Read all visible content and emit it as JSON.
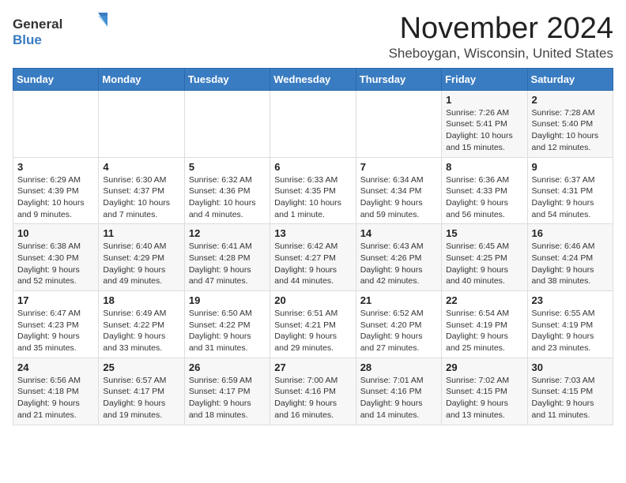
{
  "logo": {
    "general": "General",
    "blue": "Blue"
  },
  "title": "November 2024",
  "location": "Sheboygan, Wisconsin, United States",
  "weekdays": [
    "Sunday",
    "Monday",
    "Tuesday",
    "Wednesday",
    "Thursday",
    "Friday",
    "Saturday"
  ],
  "weeks": [
    [
      {
        "day": "",
        "info": ""
      },
      {
        "day": "",
        "info": ""
      },
      {
        "day": "",
        "info": ""
      },
      {
        "day": "",
        "info": ""
      },
      {
        "day": "",
        "info": ""
      },
      {
        "day": "1",
        "info": "Sunrise: 7:26 AM\nSunset: 5:41 PM\nDaylight: 10 hours and 15 minutes."
      },
      {
        "day": "2",
        "info": "Sunrise: 7:28 AM\nSunset: 5:40 PM\nDaylight: 10 hours and 12 minutes."
      }
    ],
    [
      {
        "day": "3",
        "info": "Sunrise: 6:29 AM\nSunset: 4:39 PM\nDaylight: 10 hours and 9 minutes."
      },
      {
        "day": "4",
        "info": "Sunrise: 6:30 AM\nSunset: 4:37 PM\nDaylight: 10 hours and 7 minutes."
      },
      {
        "day": "5",
        "info": "Sunrise: 6:32 AM\nSunset: 4:36 PM\nDaylight: 10 hours and 4 minutes."
      },
      {
        "day": "6",
        "info": "Sunrise: 6:33 AM\nSunset: 4:35 PM\nDaylight: 10 hours and 1 minute."
      },
      {
        "day": "7",
        "info": "Sunrise: 6:34 AM\nSunset: 4:34 PM\nDaylight: 9 hours and 59 minutes."
      },
      {
        "day": "8",
        "info": "Sunrise: 6:36 AM\nSunset: 4:33 PM\nDaylight: 9 hours and 56 minutes."
      },
      {
        "day": "9",
        "info": "Sunrise: 6:37 AM\nSunset: 4:31 PM\nDaylight: 9 hours and 54 minutes."
      }
    ],
    [
      {
        "day": "10",
        "info": "Sunrise: 6:38 AM\nSunset: 4:30 PM\nDaylight: 9 hours and 52 minutes."
      },
      {
        "day": "11",
        "info": "Sunrise: 6:40 AM\nSunset: 4:29 PM\nDaylight: 9 hours and 49 minutes."
      },
      {
        "day": "12",
        "info": "Sunrise: 6:41 AM\nSunset: 4:28 PM\nDaylight: 9 hours and 47 minutes."
      },
      {
        "day": "13",
        "info": "Sunrise: 6:42 AM\nSunset: 4:27 PM\nDaylight: 9 hours and 44 minutes."
      },
      {
        "day": "14",
        "info": "Sunrise: 6:43 AM\nSunset: 4:26 PM\nDaylight: 9 hours and 42 minutes."
      },
      {
        "day": "15",
        "info": "Sunrise: 6:45 AM\nSunset: 4:25 PM\nDaylight: 9 hours and 40 minutes."
      },
      {
        "day": "16",
        "info": "Sunrise: 6:46 AM\nSunset: 4:24 PM\nDaylight: 9 hours and 38 minutes."
      }
    ],
    [
      {
        "day": "17",
        "info": "Sunrise: 6:47 AM\nSunset: 4:23 PM\nDaylight: 9 hours and 35 minutes."
      },
      {
        "day": "18",
        "info": "Sunrise: 6:49 AM\nSunset: 4:22 PM\nDaylight: 9 hours and 33 minutes."
      },
      {
        "day": "19",
        "info": "Sunrise: 6:50 AM\nSunset: 4:22 PM\nDaylight: 9 hours and 31 minutes."
      },
      {
        "day": "20",
        "info": "Sunrise: 6:51 AM\nSunset: 4:21 PM\nDaylight: 9 hours and 29 minutes."
      },
      {
        "day": "21",
        "info": "Sunrise: 6:52 AM\nSunset: 4:20 PM\nDaylight: 9 hours and 27 minutes."
      },
      {
        "day": "22",
        "info": "Sunrise: 6:54 AM\nSunset: 4:19 PM\nDaylight: 9 hours and 25 minutes."
      },
      {
        "day": "23",
        "info": "Sunrise: 6:55 AM\nSunset: 4:19 PM\nDaylight: 9 hours and 23 minutes."
      }
    ],
    [
      {
        "day": "24",
        "info": "Sunrise: 6:56 AM\nSunset: 4:18 PM\nDaylight: 9 hours and 21 minutes."
      },
      {
        "day": "25",
        "info": "Sunrise: 6:57 AM\nSunset: 4:17 PM\nDaylight: 9 hours and 19 minutes."
      },
      {
        "day": "26",
        "info": "Sunrise: 6:59 AM\nSunset: 4:17 PM\nDaylight: 9 hours and 18 minutes."
      },
      {
        "day": "27",
        "info": "Sunrise: 7:00 AM\nSunset: 4:16 PM\nDaylight: 9 hours and 16 minutes."
      },
      {
        "day": "28",
        "info": "Sunrise: 7:01 AM\nSunset: 4:16 PM\nDaylight: 9 hours and 14 minutes."
      },
      {
        "day": "29",
        "info": "Sunrise: 7:02 AM\nSunset: 4:15 PM\nDaylight: 9 hours and 13 minutes."
      },
      {
        "day": "30",
        "info": "Sunrise: 7:03 AM\nSunset: 4:15 PM\nDaylight: 9 hours and 11 minutes."
      }
    ]
  ]
}
